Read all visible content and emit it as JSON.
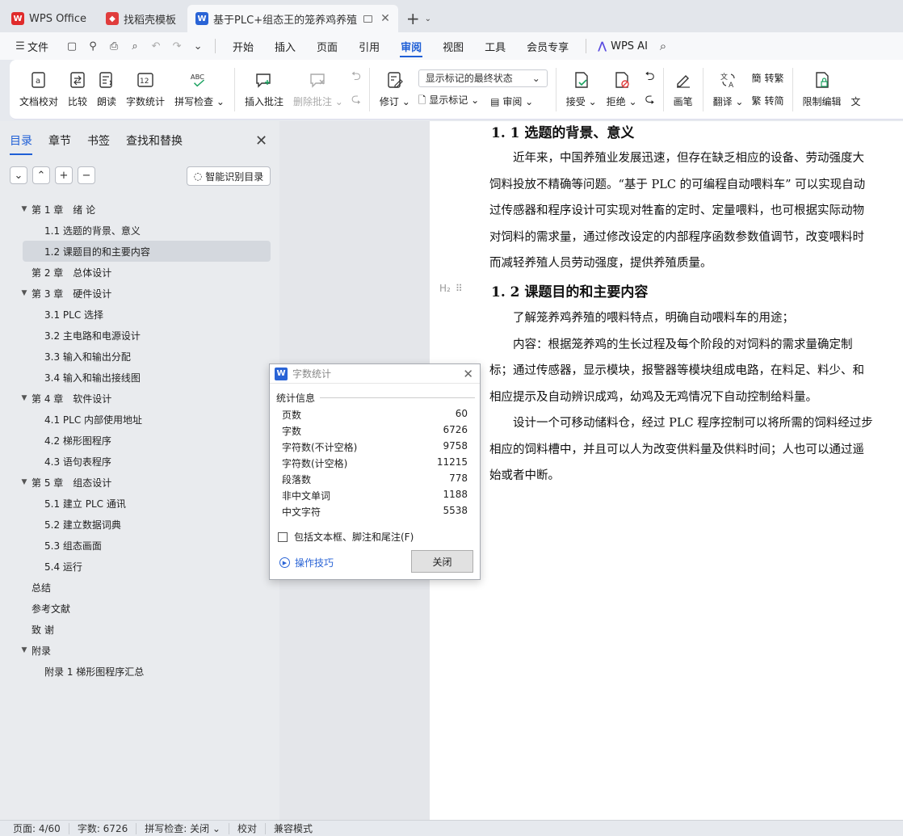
{
  "tabs": [
    {
      "label": "WPS Office",
      "color": "#e02b2b",
      "logo": "W",
      "active": false
    },
    {
      "label": "找稻壳模板",
      "color": "#e03c3c",
      "logo": "◆",
      "active": false
    },
    {
      "label": "基于PLC+组态王的笼养鸡养殖",
      "color": "#2a64d6",
      "logo": "W",
      "active": true
    }
  ],
  "menubar": {
    "file": "文件",
    "items": [
      "开始",
      "插入",
      "页面",
      "引用",
      "审阅",
      "视图",
      "工具",
      "会员专享"
    ],
    "active": "审阅",
    "ai": "WPS AI"
  },
  "ribbon": {
    "doc_check": "文档校对",
    "compare": "比较",
    "read": "朗读",
    "word_count": "字数统计",
    "spell_check": "拼写检查",
    "insert_comment": "插入批注",
    "delete_comment": "删除批注",
    "revise": "修订",
    "markup_select": "显示标记的最终状态",
    "show_markup": "显示标记",
    "review": "审阅",
    "accept": "接受",
    "reject": "拒绝",
    "pen": "画笔",
    "translate": "翻译",
    "to_traditional": "转繁",
    "to_simplified": "转简",
    "restrict_edit": "限制编辑",
    "cut_text": "文"
  },
  "nav": {
    "tabs": [
      "目录",
      "章节",
      "书签",
      "查找和替换"
    ],
    "smart_toc": "智能识别目录",
    "toc": [
      {
        "text": "第 1 章　绪  论",
        "level": 1,
        "expanded": true
      },
      {
        "text": "1.1 选题的背景、意义",
        "level": 2
      },
      {
        "text": "1.2 课题目的和主要内容",
        "level": 2,
        "selected": true
      },
      {
        "text": "第 2 章　总体设计",
        "level": 1
      },
      {
        "text": "第 3 章　硬件设计",
        "level": 1,
        "expanded": true
      },
      {
        "text": "3.1 PLC 选择",
        "level": 2
      },
      {
        "text": "3.2  主电路和电源设计",
        "level": 2
      },
      {
        "text": "3.3  输入和输出分配",
        "level": 2
      },
      {
        "text": "3.4  输入和输出接线图",
        "level": 2
      },
      {
        "text": "第 4 章　软件设计",
        "level": 1,
        "expanded": true
      },
      {
        "text": "4.1 PLC 内部使用地址",
        "level": 2
      },
      {
        "text": "4.2  梯形图程序",
        "level": 2
      },
      {
        "text": "4.3  语句表程序",
        "level": 2
      },
      {
        "text": "第 5 章　组态设计",
        "level": 1,
        "expanded": true
      },
      {
        "text": "5.1 建立 PLC 通讯",
        "level": 2
      },
      {
        "text": "5.2  建立数据词典",
        "level": 2
      },
      {
        "text": "5.3  组态画面",
        "level": 2
      },
      {
        "text": "5.4 运行",
        "level": 2
      },
      {
        "text": "总结",
        "level": 1
      },
      {
        "text": "参考文献",
        "level": 1
      },
      {
        "text": "致  谢",
        "level": 1
      },
      {
        "text": "附录",
        "level": 1,
        "expanded": true
      },
      {
        "text": "附录 1  梯形图程序汇总",
        "level": 2
      }
    ]
  },
  "document": {
    "h1": "1. 1 选题的背景、意义",
    "p1": [
      "　　近年来，中国养殖业发展迅速，但存在缺乏相应的设备、劳动强度大",
      "饲料投放不精确等问题。“基于 PLC 的可编程自动喂料车” 可以实现自动",
      "过传感器和程序设计可实现对牲畜的定时、定量喂料，也可根据实际动物",
      "对饲料的需求量，通过修改设定的内部程序函数参数值调节，改变喂料时",
      "而减轻养殖人员劳动强度，提供养殖质量。"
    ],
    "h2": "1. 2 课题目的和主要内容",
    "h2_marker": "H₂",
    "p2": [
      "　　了解笼养鸡养殖的喂料特点，明确自动喂料车的用途；",
      "　　内容：根据笼养鸡的生长过程及每个阶段的对饲料的需求量确定制",
      "标；通过传感器，显示模块，报警器等模块组成电路，在料足、料少、和",
      "相应提示及自动辨识成鸡，幼鸡及无鸡情况下自动控制给料量。",
      "　　设计一个可移动储料仓，经过 PLC 程序控制可以将所需的饲料经过步",
      "相应的饲料槽中，并且可以人为改变供料量及供料时间；人也可以通过遥",
      "始或者中断。"
    ]
  },
  "dialog": {
    "title": "字数统计",
    "section": "统计信息",
    "stats": [
      {
        "label": "页数",
        "value": "60"
      },
      {
        "label": "字数",
        "value": "6726"
      },
      {
        "label": "字符数(不计空格)",
        "value": "9758"
      },
      {
        "label": "字符数(计空格)",
        "value": "11215"
      },
      {
        "label": "段落数",
        "value": "778"
      },
      {
        "label": "非中文单词",
        "value": "1188"
      },
      {
        "label": "中文字符",
        "value": "5538"
      }
    ],
    "checkbox": "包括文本框、脚注和尾注(F)",
    "tips": "操作技巧",
    "close": "关闭"
  },
  "status": {
    "page": "页面: 4/60",
    "words": "字数: 6726",
    "spell": "拼写检查: 关闭",
    "proof": "校对",
    "compat": "兼容模式"
  }
}
